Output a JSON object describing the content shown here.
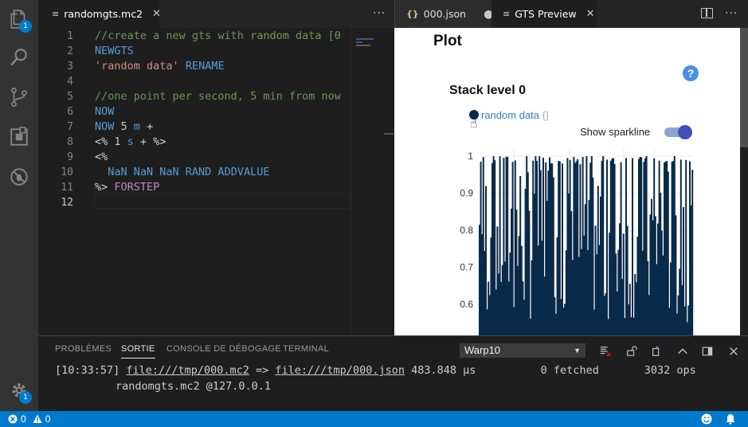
{
  "activity": {
    "explorer_badge": "1",
    "settings_badge": "1",
    "icons": [
      "files-icon",
      "search-icon",
      "source-control-icon",
      "extensions-icon",
      "debug-icon",
      "gear-icon"
    ]
  },
  "editor1": {
    "tab": {
      "label": "randomgts.mc2",
      "icon": "≡"
    },
    "lines": [
      {
        "n": "1",
        "parts": [
          [
            "c-comment",
            "//create a new gts with random data [0"
          ]
        ]
      },
      {
        "n": "2",
        "parts": [
          [
            "c-kw",
            "NEWGTS"
          ]
        ]
      },
      {
        "n": "3",
        "parts": [
          [
            "c-str",
            "'random data'"
          ],
          [
            "c-plain",
            " "
          ],
          [
            "c-kw",
            "RENAME"
          ]
        ]
      },
      {
        "n": "4",
        "parts": []
      },
      {
        "n": "5",
        "parts": [
          [
            "c-comment",
            "//one point per second, 5 min from now"
          ]
        ]
      },
      {
        "n": "6",
        "parts": [
          [
            "c-kw",
            "NOW"
          ]
        ]
      },
      {
        "n": "7",
        "parts": [
          [
            "c-kw",
            "NOW"
          ],
          [
            "c-plain",
            " "
          ],
          [
            "c-num",
            "5"
          ],
          [
            "c-plain",
            " "
          ],
          [
            "c-kw",
            "m"
          ],
          [
            "c-plain",
            " +"
          ]
        ]
      },
      {
        "n": "8",
        "parts": [
          [
            "c-plain",
            "<% "
          ],
          [
            "c-num",
            "1"
          ],
          [
            "c-plain",
            " "
          ],
          [
            "c-kw",
            "s"
          ],
          [
            "c-plain",
            " + %>"
          ]
        ]
      },
      {
        "n": "9",
        "parts": [
          [
            "c-plain",
            "<%"
          ]
        ]
      },
      {
        "n": "10",
        "parts": [
          [
            "c-plain",
            "  "
          ],
          [
            "c-kw",
            "NaN NaN NaN RAND ADDVALUE"
          ]
        ]
      },
      {
        "n": "11",
        "parts": [
          [
            "c-plain",
            "%> "
          ],
          [
            "c-macro",
            "FORSTEP"
          ]
        ]
      },
      {
        "n": "12",
        "parts": []
      }
    ]
  },
  "editor2": {
    "tab_json": {
      "label": "000.json",
      "icon": "{}"
    },
    "tab_preview": {
      "label": "GTS Preview",
      "icon": "≡"
    }
  },
  "preview": {
    "title": "Plot",
    "help": "?",
    "stack_label": "Stack level 0",
    "legend_name": "random data",
    "legend_tags": "{}",
    "sparkline_label": "Show sparkline",
    "sparkline_on": true
  },
  "chart_data": {
    "type": "bar",
    "series": [
      {
        "name": "random data",
        "color": "#0a2a4a"
      }
    ],
    "y_ticks": [
      "1",
      "0.9",
      "0.8",
      "0.7",
      "0.6"
    ],
    "ylim": [
      0.55,
      1.0
    ],
    "grid": true
  },
  "panel": {
    "tabs": [
      "PROBLÈMES",
      "SORTIE",
      "CONSOLE DE DÉBOGAGE",
      "TERMINAL"
    ],
    "active_tab": "SORTIE",
    "output_channel": "Warp10",
    "output_line1": {
      "time": "[10:33:57]",
      "src": "file:///tmp/000.mc2",
      "arrow": "=>",
      "dst": "file:///tmp/000.json",
      "duration": "483.848 µs",
      "fetched": "0 fetched",
      "ops": "3032 ops"
    },
    "output_line2": "randomgts.mc2 @127.0.0.1"
  },
  "status": {
    "errors": "0",
    "warnings": "0"
  }
}
